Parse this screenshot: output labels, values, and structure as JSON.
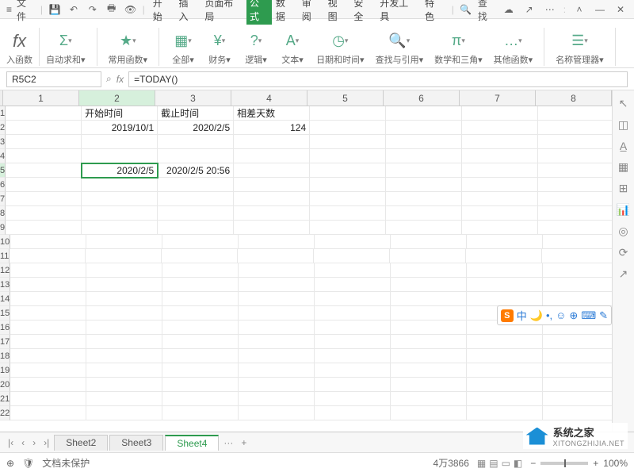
{
  "menu": {
    "file": "文件",
    "tabs": [
      "开始",
      "插入",
      "页面布局",
      "公式",
      "数据",
      "审阅",
      "视图",
      "安全",
      "开发工具",
      "特色"
    ],
    "active_tab_index": 3,
    "search_label": "查找",
    "window_icons": [
      "min",
      "restore",
      "close"
    ]
  },
  "ribbon": {
    "groups": [
      {
        "label": "入函数",
        "icon": "fx"
      },
      {
        "label": "自动求和",
        "icon": "Σ"
      },
      {
        "label": "常用函数",
        "icon": "★"
      },
      {
        "label": "全部",
        "icon": "▦"
      },
      {
        "label": "财务",
        "icon": "¥"
      },
      {
        "label": "逻辑",
        "icon": "?"
      },
      {
        "label": "文本",
        "icon": "A"
      },
      {
        "label": "日期和时间",
        "icon": "◷"
      },
      {
        "label": "查找与引用",
        "icon": "🔍"
      },
      {
        "label": "数学和三角",
        "icon": "π"
      },
      {
        "label": "其他函数",
        "icon": "…"
      },
      {
        "label": "名称管理器",
        "icon": "☰"
      }
    ]
  },
  "formula_bar": {
    "cell_ref": "R5C2",
    "formula": "=TODAY()"
  },
  "grid": {
    "columns": [
      "1",
      "2",
      "3",
      "4",
      "5",
      "6",
      "7",
      "8"
    ],
    "active_col_index": 1,
    "active_row_index": 4,
    "rows": [
      {
        "n": "1",
        "cells": [
          "",
          "开始时间",
          "截止时间",
          "相差天数",
          "",
          "",
          "",
          ""
        ],
        "align": [
          "",
          "left",
          "left",
          "left",
          "",
          "",
          "",
          ""
        ]
      },
      {
        "n": "2",
        "cells": [
          "",
          "2019/10/1",
          "2020/2/5",
          "124",
          "",
          "",
          "",
          ""
        ]
      },
      {
        "n": "3",
        "cells": [
          "",
          "",
          "",
          "",
          "",
          "",
          "",
          ""
        ]
      },
      {
        "n": "4",
        "cells": [
          "",
          "",
          "",
          "",
          "",
          "",
          "",
          ""
        ]
      },
      {
        "n": "5",
        "cells": [
          "",
          "2020/2/5",
          "2020/2/5 20:56",
          "",
          "",
          "",
          "",
          ""
        ]
      },
      {
        "n": "6",
        "cells": [
          "",
          "",
          "",
          "",
          "",
          "",
          "",
          ""
        ]
      },
      {
        "n": "7",
        "cells": [
          "",
          "",
          "",
          "",
          "",
          "",
          "",
          ""
        ]
      },
      {
        "n": "8",
        "cells": [
          "",
          "",
          "",
          "",
          "",
          "",
          "",
          ""
        ]
      },
      {
        "n": "9",
        "cells": [
          "",
          "",
          "",
          "",
          "",
          "",
          "",
          ""
        ]
      },
      {
        "n": "10",
        "cells": [
          "",
          "",
          "",
          "",
          "",
          "",
          "",
          ""
        ]
      },
      {
        "n": "11",
        "cells": [
          "",
          "",
          "",
          "",
          "",
          "",
          "",
          ""
        ]
      },
      {
        "n": "12",
        "cells": [
          "",
          "",
          "",
          "",
          "",
          "",
          "",
          ""
        ]
      },
      {
        "n": "13",
        "cells": [
          "",
          "",
          "",
          "",
          "",
          "",
          "",
          ""
        ]
      },
      {
        "n": "14",
        "cells": [
          "",
          "",
          "",
          "",
          "",
          "",
          "",
          ""
        ]
      },
      {
        "n": "15",
        "cells": [
          "",
          "",
          "",
          "",
          "",
          "",
          "",
          ""
        ]
      },
      {
        "n": "16",
        "cells": [
          "",
          "",
          "",
          "",
          "",
          "",
          "",
          ""
        ]
      },
      {
        "n": "17",
        "cells": [
          "",
          "",
          "",
          "",
          "",
          "",
          "",
          ""
        ]
      },
      {
        "n": "18",
        "cells": [
          "",
          "",
          "",
          "",
          "",
          "",
          "",
          ""
        ]
      },
      {
        "n": "19",
        "cells": [
          "",
          "",
          "",
          "",
          "",
          "",
          "",
          ""
        ]
      },
      {
        "n": "20",
        "cells": [
          "",
          "",
          "",
          "",
          "",
          "",
          "",
          ""
        ]
      },
      {
        "n": "21",
        "cells": [
          "",
          "",
          "",
          "",
          "",
          "",
          "",
          ""
        ]
      },
      {
        "n": "22",
        "cells": [
          "",
          "",
          "",
          "",
          "",
          "",
          "",
          ""
        ]
      }
    ]
  },
  "sheets": {
    "tabs": [
      "Sheet2",
      "Sheet3",
      "Sheet4"
    ],
    "active_index": 2,
    "add_label": "···",
    "plus": "+"
  },
  "status": {
    "protect": "文档未保护",
    "count": "4万3866",
    "zoom": "100%"
  },
  "ime": {
    "logo": "S",
    "chars": [
      "中",
      "🌙",
      "•,",
      "☺",
      "⊕",
      "⌨",
      "✎"
    ]
  },
  "watermark": {
    "title": "系统之家",
    "url": "XITONGZHIJIA.NET"
  }
}
